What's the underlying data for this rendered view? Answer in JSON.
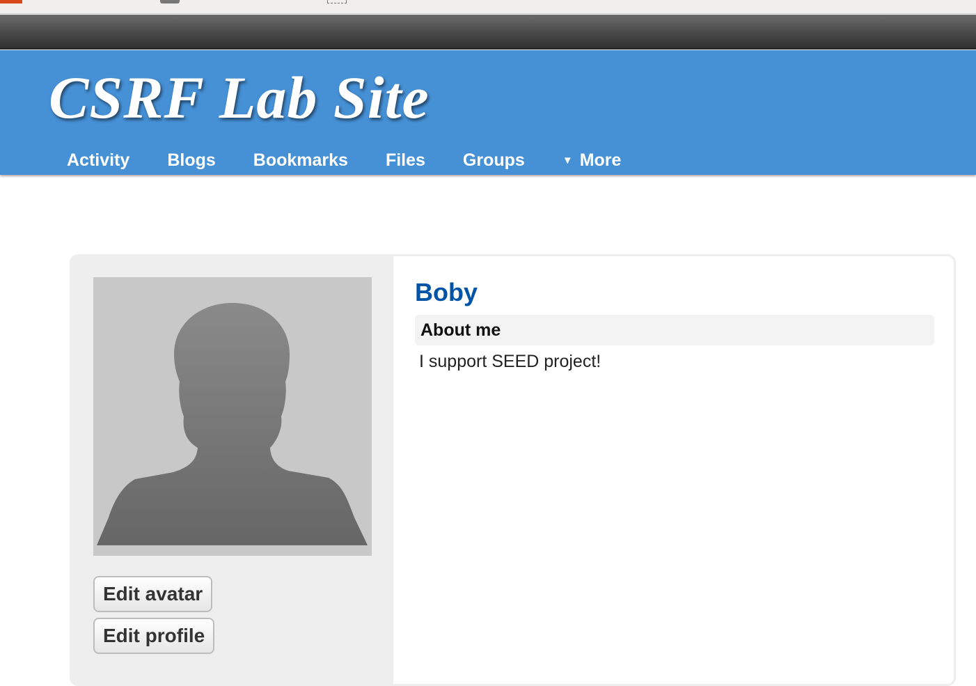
{
  "site": {
    "title": "CSRF Lab Site"
  },
  "nav": {
    "items": [
      {
        "label": "Activity"
      },
      {
        "label": "Blogs"
      },
      {
        "label": "Bookmarks"
      },
      {
        "label": "Files"
      },
      {
        "label": "Groups"
      }
    ],
    "more_label": "More",
    "more_caret": "▼"
  },
  "profile": {
    "name": "Boby",
    "about_label": "About me",
    "about_text": "I support SEED project!",
    "avatar_icon": "default-user-silhouette-icon",
    "edit_avatar_label": "Edit avatar",
    "edit_profile_label": "Edit profile"
  },
  "colors": {
    "header_blue": "#4690d6",
    "name_blue": "#0054a7",
    "panel_gray": "#eeeeee"
  }
}
